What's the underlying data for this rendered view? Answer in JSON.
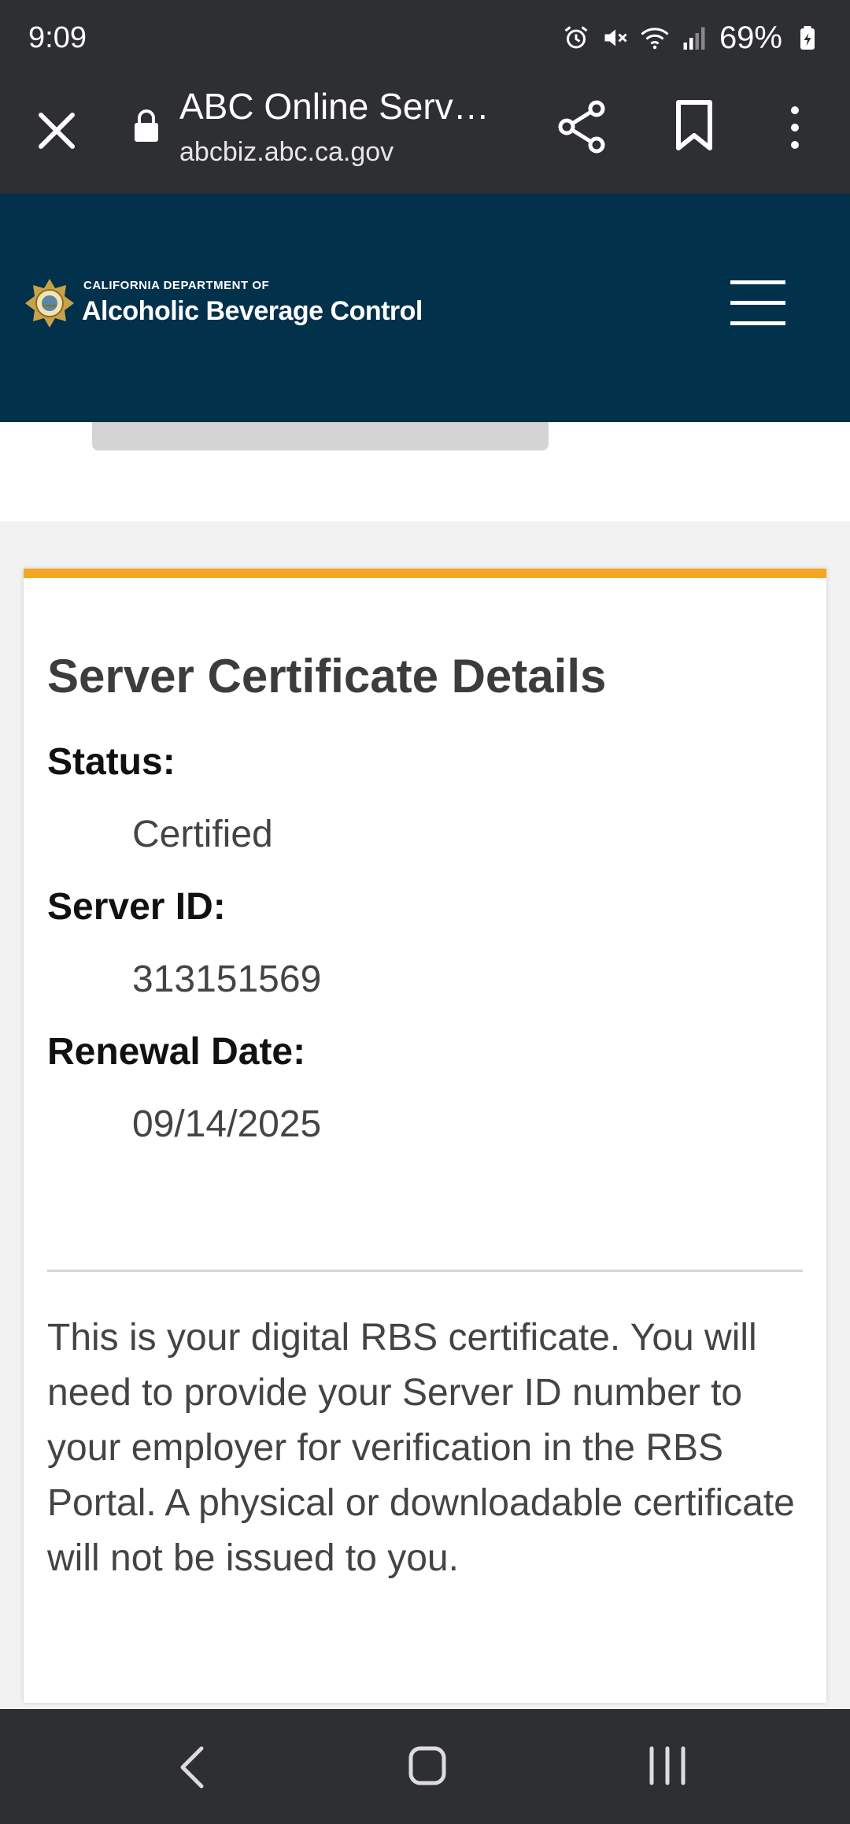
{
  "status_bar": {
    "time": "9:09",
    "battery": "69%",
    "icons": [
      "alarm-icon",
      "mute-icon",
      "wifi-icon",
      "signal-icon",
      "battery-icon"
    ]
  },
  "browser": {
    "title": "ABC Online Servi…",
    "url": "abcbiz.abc.ca.gov",
    "icons": [
      "close-icon",
      "lock-icon",
      "share-icon",
      "bookmark-icon",
      "more-vert-icon"
    ]
  },
  "site_header": {
    "org_sub": "CALIFORNIA DEPARTMENT OF",
    "org_name": "Alcoholic Beverage Control",
    "bg_color": "#02314b"
  },
  "card": {
    "accent_color": "#f5a623",
    "title": "Server Certificate Details",
    "fields": [
      {
        "label": "Status:",
        "value": "Certified"
      },
      {
        "label": "Server ID:",
        "value": "313151569"
      },
      {
        "label": "Renewal Date:",
        "value": "09/14/2025"
      }
    ],
    "note": "This is your digital RBS certificate. You will need to provide your Server ID number to your employer for verification in the RBS Portal. A physical or downloadable certificate will not be issued to you."
  },
  "nav_bar": {
    "icons": [
      "back-icon",
      "home-icon",
      "recent-apps-icon"
    ]
  }
}
